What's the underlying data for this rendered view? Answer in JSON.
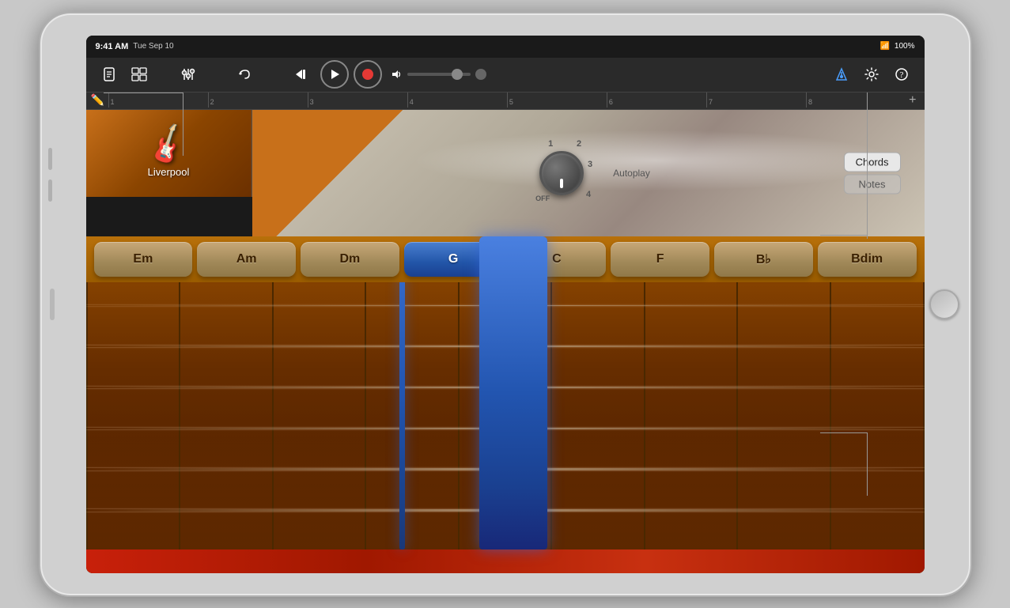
{
  "status_bar": {
    "time": "9:41 AM",
    "date": "Tue Sep 10",
    "wifi": "WiFi",
    "battery": "100%"
  },
  "toolbar": {
    "new_btn": "📄",
    "tracks_btn": "🎛",
    "mixer_btn": "⊞",
    "undo_btn": "↩",
    "rewind_btn": "⏮",
    "play_btn": "▶",
    "record_label": "●",
    "metronome_btn": "🔔",
    "settings_btn": "⚙",
    "help_btn": "?"
  },
  "ruler": {
    "marks": [
      "1",
      "2",
      "3",
      "4",
      "5",
      "6",
      "7",
      "8"
    ]
  },
  "track": {
    "name": "Liverpool",
    "icon": "🎸"
  },
  "autoplay": {
    "label": "Autoplay",
    "knob_positions": [
      "1",
      "2",
      "3",
      "4",
      "OFF"
    ]
  },
  "chords_notes": {
    "chords_label": "Chords",
    "notes_label": "Notes",
    "active": "chords"
  },
  "chord_buttons": [
    {
      "label": "Em",
      "active": false
    },
    {
      "label": "Am",
      "active": false
    },
    {
      "label": "Dm",
      "active": false
    },
    {
      "label": "G",
      "active": true
    },
    {
      "label": "C",
      "active": false
    },
    {
      "label": "F",
      "active": false
    },
    {
      "label": "B♭",
      "active": false
    },
    {
      "label": "Bdim",
      "active": false
    }
  ],
  "strings": [
    {
      "top": "8%"
    },
    {
      "top": "22%"
    },
    {
      "top": "36%"
    },
    {
      "top": "50%"
    },
    {
      "top": "64%"
    },
    {
      "top": "78%"
    }
  ],
  "fret_cols": 9
}
